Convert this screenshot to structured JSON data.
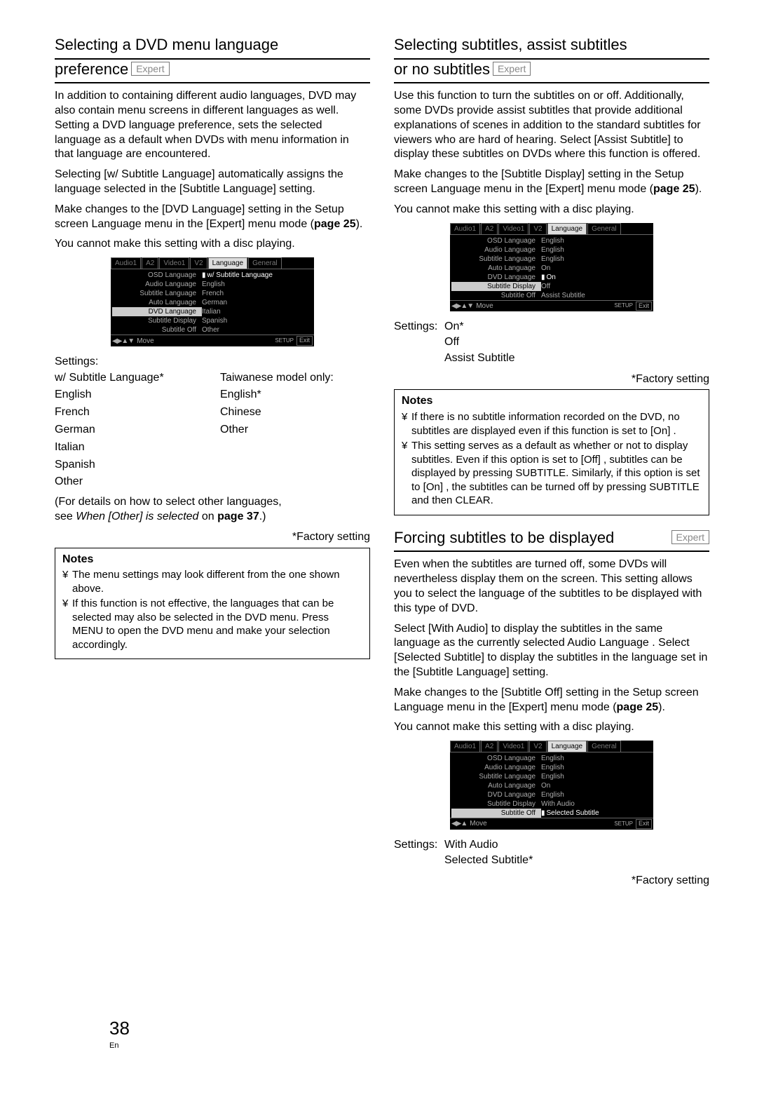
{
  "page_number": "38",
  "page_lang": "En",
  "expert_label": "Expert",
  "left": {
    "title_line1": "Selecting a DVD menu language",
    "title_line2": "preference",
    "para1": "In addition to containing different audio languages, DVD may also contain menu screens in different languages as well. Setting a DVD language preference, sets the selected language as a default when DVDs with menu information in that language are encountered.",
    "para2a": "Selecting [w/ Subtitle Language]",
    "para2b": " automatically assigns the language selected in the [Subtitle Language] setting.",
    "para3a": "Make changes to the [DVD Language] setting in the Setup screen Language menu in the [Expert] menu mode (",
    "para3b": "page 25",
    "para3c": ").",
    "para4": "You cannot make this setting with a disc playing.",
    "settings_label": "Settings:",
    "col1": [
      "w/ Subtitle Language*",
      "English",
      "French",
      "German",
      "Italian",
      "Spanish",
      "Other"
    ],
    "col2_header": "Taiwanese model only:",
    "col2": [
      "English*",
      "Chinese",
      "Other"
    ],
    "details_a": "(For details on how to select other languages,",
    "details_b": "see ",
    "details_c": "When [Other] is selected",
    "details_d": " on ",
    "details_e": "page 37",
    "details_f": ".)",
    "factory": "*Factory setting",
    "notes_title": "Notes",
    "note1": "The menu settings may look different from the one shown above.",
    "note2": "If this function is not effective, the languages that can be selected may also be selected in the DVD menu. Press MENU to open the DVD menu and make your selection accordingly."
  },
  "right1": {
    "title_line1": "Selecting subtitles, assist subtitles",
    "title_line2": "or no subtitles",
    "para1": "Use this function to turn the subtitles on or off. Additionally, some DVDs provide assist subtitles that provide additional explanations of scenes in addition to the standard subtitles for viewers who are hard of hearing. Select [Assist Subtitle]   to display these subtitles on DVDs where this function is offered.",
    "para2a": "Make changes to the [Subtitle Display]  setting in the Setup screen Language menu in the [Expert] menu mode (",
    "para2b": "page 25",
    "para2c": ").",
    "para3": "You cannot make this setting with a disc playing.",
    "settings_label": "Settings:",
    "opts": [
      "On*",
      "Off",
      "Assist Subtitle"
    ],
    "factory": "*Factory setting",
    "notes_title": "Notes",
    "note1": "If there is no subtitle information recorded on the DVD, no subtitles are displayed even if this function is set to [On] .",
    "note2": "This setting serves as a default as whether or not to display subtitles. Even if this option is set to [Off] , subtitles can be displayed by pressing SUBTITLE. Similarly, if this option is set to [On] , the subtitles can be turned off by pressing SUBTITLE and then CLEAR."
  },
  "right2": {
    "title": "Forcing subtitles to be displayed",
    "para1": "Even when the subtitles are turned off, some DVDs will nevertheless display them on the screen. This setting allows you to select the language of the subtitles to be displayed with this type of DVD.",
    "para2": "Select [With Audio]   to display the subtitles in the same language as the currently selected Audio Language . Select [Selected Subtitle]   to display the subtitles in the language set in the [Subtitle Language]   setting.",
    "para3a": "Make changes to the [Subtitle Off]  setting in the Setup screen Language menu in the [Expert] menu mode (",
    "para3b": "page 25",
    "para3c": ").",
    "para4": "You cannot make this setting with a disc playing.",
    "settings_label": "Settings:",
    "opts": [
      "With Audio",
      "Selected Subtitle*"
    ],
    "factory": "*Factory setting"
  },
  "menus": {
    "tabs": [
      "Audio1",
      "A2",
      "Video1",
      "V2",
      "Language",
      "General"
    ],
    "move": "Move",
    "setup": "SETUP",
    "exit": "Exit",
    "m1": {
      "rows": [
        {
          "l": "OSD Language",
          "v": "w/ Subtitle Language",
          "hv": true,
          "ptr": true
        },
        {
          "l": "Audio Language",
          "v": "English"
        },
        {
          "l": "Subtitle Language",
          "v": "French"
        },
        {
          "l": "Auto Language",
          "v": "German"
        },
        {
          "l": "DVD Language",
          "v": "Italian",
          "hl": true
        },
        {
          "l": "Subtitle Display",
          "v": "Spanish"
        },
        {
          "l": "Subtitle Off",
          "v": "Other"
        }
      ]
    },
    "m2": {
      "rows": [
        {
          "l": "OSD Language",
          "v": "English"
        },
        {
          "l": "Audio Language",
          "v": "English"
        },
        {
          "l": "Subtitle Language",
          "v": "English"
        },
        {
          "l": "Auto Language",
          "v": "On"
        },
        {
          "l": "DVD Language",
          "v": "On",
          "hv": true,
          "ptr": true
        },
        {
          "l": "Subtitle Display",
          "v": "Off",
          "hl": true
        },
        {
          "l": "Subtitle Off",
          "v": "Assist Subtitle"
        }
      ]
    },
    "m3": {
      "rows": [
        {
          "l": "OSD Language",
          "v": "English"
        },
        {
          "l": "Audio Language",
          "v": "English"
        },
        {
          "l": "Subtitle Language",
          "v": "English"
        },
        {
          "l": "Auto Language",
          "v": "On"
        },
        {
          "l": "DVD Language",
          "v": "English"
        },
        {
          "l": "Subtitle Display",
          "v": "With Audio"
        },
        {
          "l": "Subtitle Off",
          "v": "Selected Subtitle",
          "hl": true,
          "hv": true,
          "ptr": true
        }
      ]
    }
  }
}
